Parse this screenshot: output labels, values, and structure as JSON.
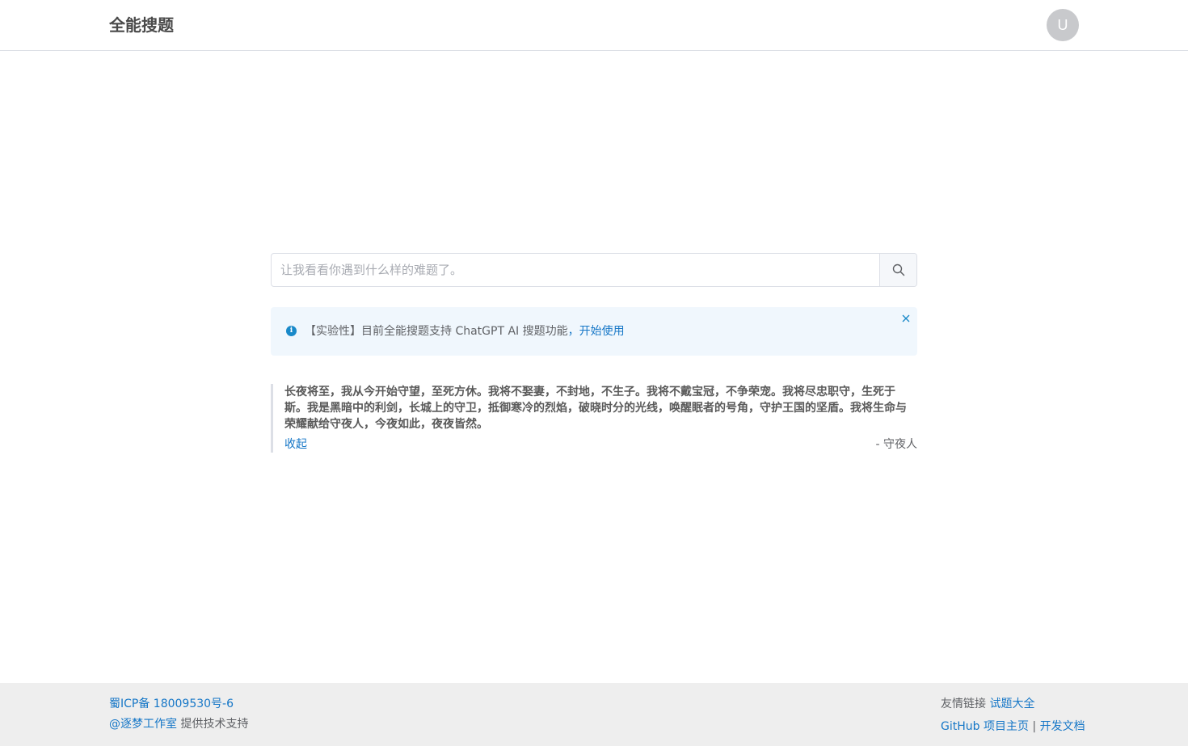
{
  "header": {
    "brand": "全能搜题",
    "avatar_letter": "U"
  },
  "search": {
    "placeholder": "让我看看你遇到什么样的难题了。",
    "value": "",
    "button_icon": "search-icon"
  },
  "notice": {
    "icon": "info-icon",
    "text": "【实验性】目前全能搜题支持 ChatGPT AI 搜题功能",
    "separator": "，",
    "link_label": "开始使用",
    "close_icon": "close-icon",
    "accent_color": "#1989c9"
  },
  "quote": {
    "text": "长夜将至，我从今开始守望，至死方休。我将不娶妻，不封地，不生子。我将不戴宝冠，不争荣宠。我将尽忠职守，生死于斯。我是黑暗中的利剑，长城上的守卫，抵御寒冷的烈焰，破晓时分的光线，唤醒眠者的号角，守护王国的坚盾。我将生命与荣耀献给守夜人，今夜如此，夜夜皆然。",
    "collapse_label": "收起",
    "author": "- 守夜人"
  },
  "footer": {
    "icp": "蜀ICP备 18009530号-6",
    "studio_link": "@逐梦工作室",
    "studio_suffix": " 提供技术支持",
    "friends_label": "友情链接",
    "friends_link": "试题大全",
    "github_label": "GitHub 项目主页",
    "divider": "|",
    "docs_label": "开发文档"
  },
  "colors": {
    "link": "#1677c7",
    "notice_bg": "#f0f7fd",
    "footer_bg": "#eeeeee"
  }
}
